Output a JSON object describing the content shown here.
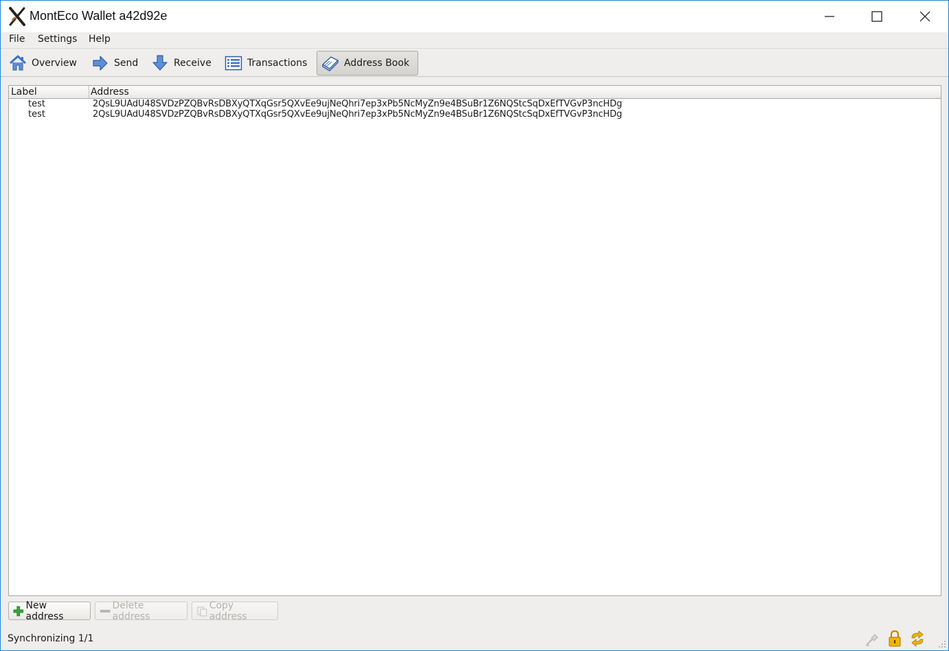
{
  "window": {
    "title": "MontEco Wallet a42d92e"
  },
  "menu": {
    "items": [
      "File",
      "Settings",
      "Help"
    ]
  },
  "toolbar": {
    "items": [
      {
        "label": "Overview",
        "icon": "home-icon"
      },
      {
        "label": "Send",
        "icon": "send-arrow-icon"
      },
      {
        "label": "Receive",
        "icon": "receive-arrow-icon"
      },
      {
        "label": "Transactions",
        "icon": "transactions-list-icon"
      },
      {
        "label": "Address Book",
        "icon": "address-book-icon",
        "active": true
      }
    ]
  },
  "table": {
    "columns": [
      "Label",
      "Address"
    ],
    "rows": [
      {
        "label": "test",
        "address": "2QsL9UAdU48SVDzPZQBvRsDBXyQTXqGsr5QXvEe9ujNeQhri7ep3xPb5NcMyZn9e4BSuBr1Z6NQStcSqDxEfTVGvP3ncHDg"
      },
      {
        "label": "test",
        "address": "2QsL9UAdU48SVDzPZQBvRsDBXyQTXqGsr5QXvEe9ujNeQhri7ep3xPb5NcMyZn9e4BSuBr1Z6NQStcSqDxEfTVGvP3ncHDg"
      }
    ]
  },
  "actions": {
    "new_address": "New address",
    "delete_address": "Delete address",
    "copy_address": "Copy address"
  },
  "status": {
    "text": "Synchronizing 1/1",
    "icons": [
      "connection-icon",
      "lock-icon",
      "sync-icon"
    ]
  },
  "colors": {
    "window_border": "#1883d7",
    "chrome_bg": "#efeeec",
    "icon_blue": "#3b73c8",
    "add_green": "#3aa53a",
    "lock_yellow": "#f0b400"
  }
}
